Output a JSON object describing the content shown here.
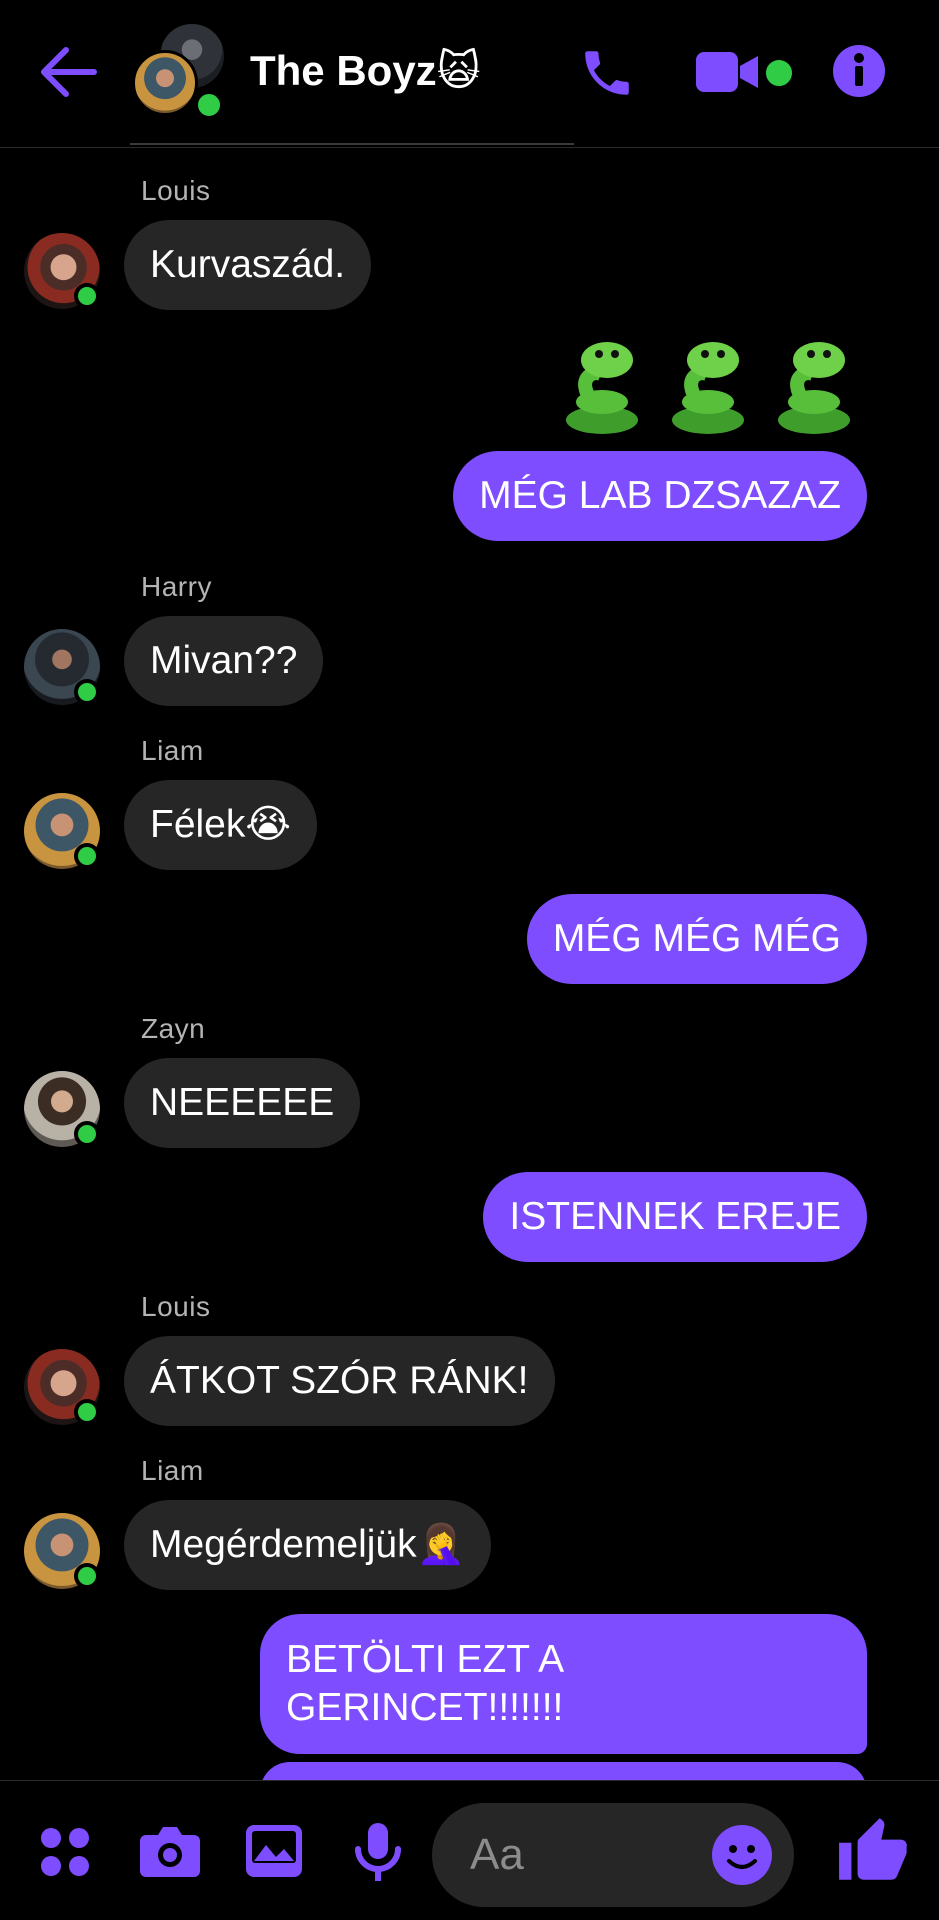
{
  "colors": {
    "accent": "#7e4dff",
    "incoming_bubble": "#262626",
    "online": "#31cc46",
    "background": "#000000"
  },
  "header": {
    "title": "The Boyz",
    "title_emoji": "🙀",
    "icons": [
      "back-arrow-icon",
      "phone-icon",
      "video-camera-icon",
      "info-icon"
    ]
  },
  "messages": [
    {
      "sender": "Louis",
      "text": "Kurvaszád.",
      "direction": "in"
    },
    {
      "emoji": "🐍🐍🐍",
      "direction": "out"
    },
    {
      "text": "MÉG LAB DZSAZAZ",
      "direction": "out"
    },
    {
      "sender": "Harry",
      "text": "Mivan??",
      "direction": "in"
    },
    {
      "sender": "Liam",
      "text": "Félek😭",
      "direction": "in"
    },
    {
      "text": "MÉG MÉG MÉG",
      "direction": "out"
    },
    {
      "sender": "Zayn",
      "text": "NEEEEEE",
      "direction": "in"
    },
    {
      "text": "ISTENNEK EREJE",
      "direction": "out"
    },
    {
      "sender": "Louis",
      "text": "ÁTKOT SZÓR RÁNK!",
      "direction": "in"
    },
    {
      "sender": "Liam",
      "text": "Megérdemeljük🤦‍♀️",
      "direction": "in"
    },
    {
      "text": "BETÖLTI EZT A GERINCET!!!!!!!",
      "direction": "out"
    }
  ],
  "composer": {
    "placeholder": "Aa",
    "icons": [
      "apps-grid-icon",
      "camera-icon",
      "gallery-icon",
      "microphone-icon",
      "emoji-icon",
      "thumbs-up-icon"
    ]
  }
}
